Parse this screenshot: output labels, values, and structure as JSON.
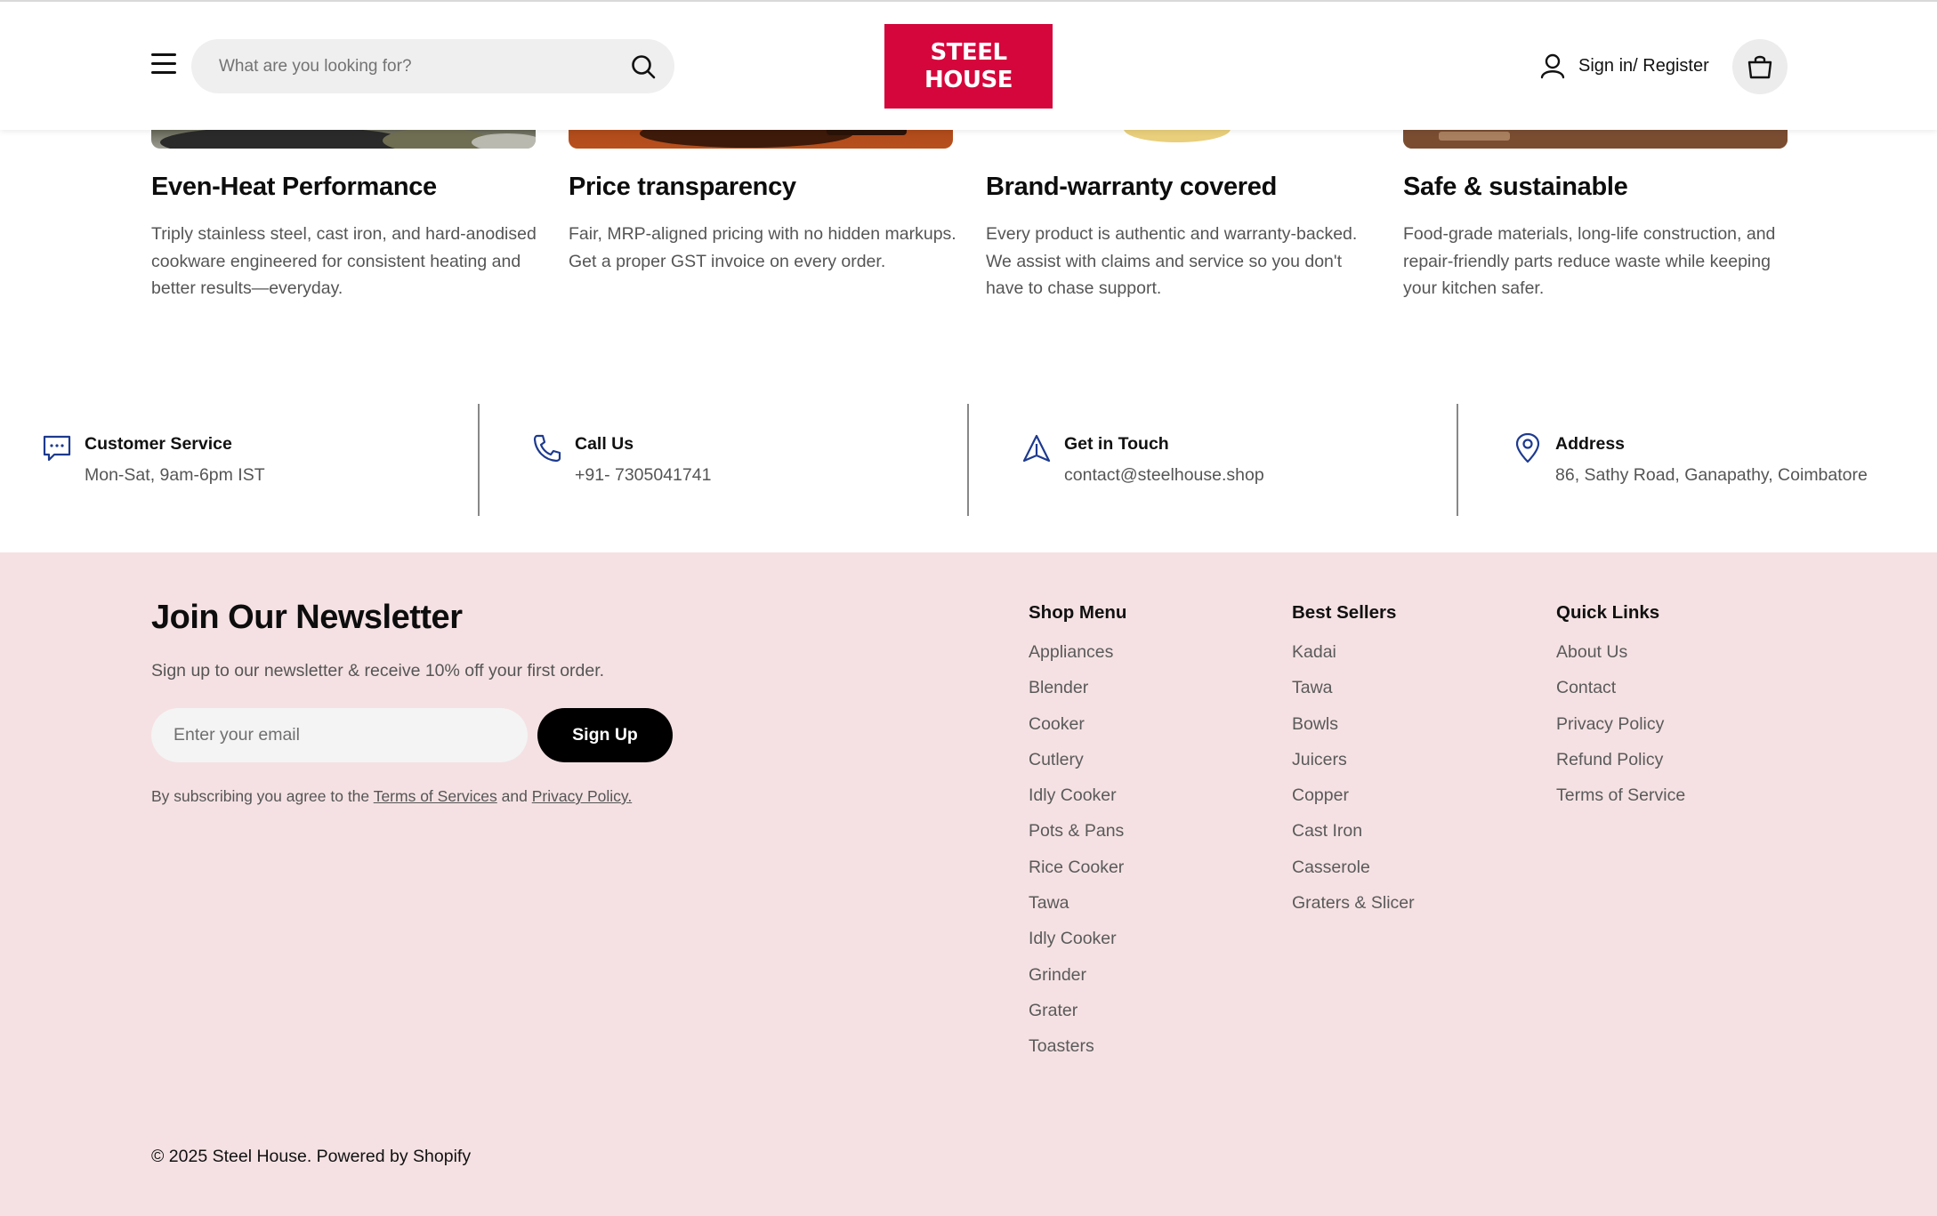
{
  "header": {
    "search_placeholder": "What are you looking for?",
    "logo_line1": "STEEL",
    "logo_line2": "HOUSE",
    "signin_label": "Sign in/ Register",
    "brand_color": "#d4063b"
  },
  "features": [
    {
      "title": "Even-Heat Performance",
      "description": "Triply stainless steel, cast iron, and hard-anodised cookware engineered for consistent heating and better results—everyday."
    },
    {
      "title": "Price transparency",
      "description": "Fair, MRP-aligned pricing with no hidden markups. Get a proper GST invoice on every order."
    },
    {
      "title": "Brand-warranty covered",
      "description": "Every product is authentic and warranty-backed. We assist with claims and service so you don't have to chase support."
    },
    {
      "title": "Safe & sustainable",
      "description": "Food-grade materials, long-life construction, and repair-friendly parts reduce waste while keeping your kitchen safer."
    }
  ],
  "contact": [
    {
      "icon": "chat-icon",
      "title": "Customer Service",
      "value": "Mon-Sat, 9am-6pm IST"
    },
    {
      "icon": "phone-icon",
      "title": "Call Us",
      "value": "+91- 7305041741"
    },
    {
      "icon": "send-icon",
      "title": "Get in Touch",
      "value": "contact@steelhouse.shop"
    },
    {
      "icon": "location-pin-icon",
      "title": "Address",
      "value": "86, Sathy Road, Ganapathy, Coimbatore"
    }
  ],
  "newsletter": {
    "title": "Join Our Newsletter",
    "subtitle": "Sign up to our newsletter & receive 10% off your first order.",
    "email_placeholder": "Enter your email",
    "button_label": "Sign Up",
    "terms_prefix": "By subscribing you agree to the",
    "terms_link": "Terms of Services",
    "terms_and": "and",
    "privacy_link": "Privacy Policy."
  },
  "footer_columns": [
    {
      "title": "Shop Menu",
      "items": [
        "Appliances",
        "Blender",
        "Cooker",
        "Cutlery",
        "Idly Cooker",
        "Pots & Pans",
        "Rice Cooker",
        "Tawa",
        "Idly Cooker",
        "Grinder",
        "Grater",
        "Toasters"
      ]
    },
    {
      "title": "Best Sellers",
      "items": [
        "Kadai",
        "Tawa",
        "Bowls",
        "Juicers",
        "Copper",
        "Cast Iron",
        "Casserole",
        "Graters & Slicer"
      ]
    },
    {
      "title": "Quick Links",
      "items": [
        "About Us",
        "Contact",
        "Privacy Policy",
        "Refund Policy",
        "Terms of Service"
      ]
    }
  ],
  "copyright": "© 2025 Steel House. Powered by Shopify",
  "colors": {
    "footer_bg": "#f5e1e3",
    "contact_icon": "#1d3a8f"
  }
}
